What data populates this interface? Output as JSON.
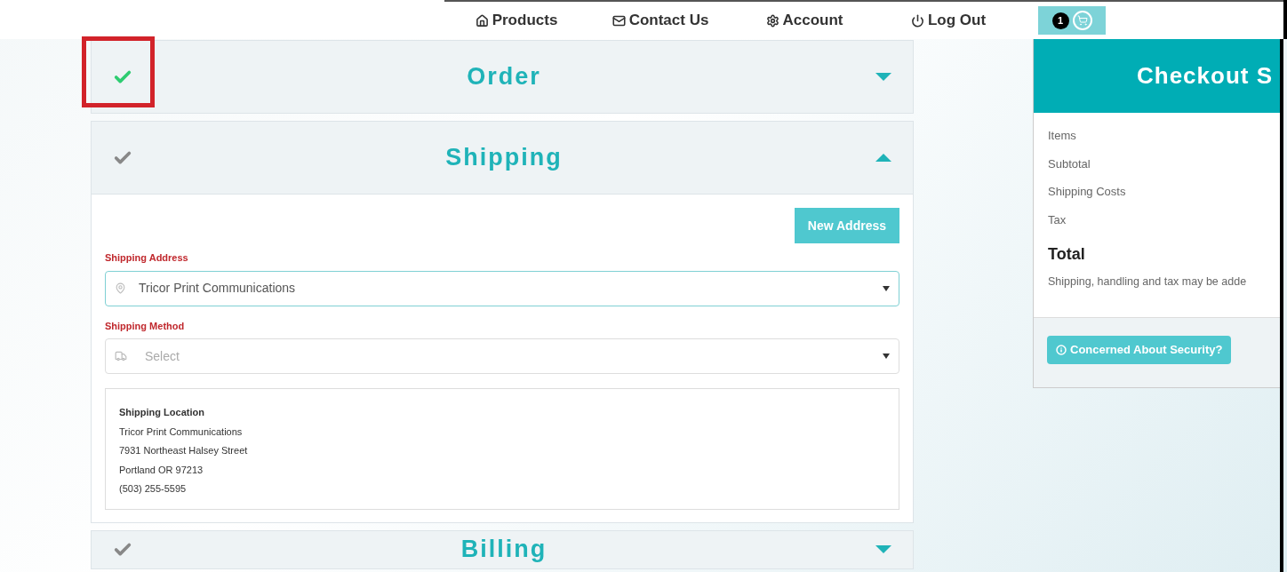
{
  "nav": {
    "items": [
      {
        "label": "Products"
      },
      {
        "label": "Contact Us"
      },
      {
        "label": "Account"
      },
      {
        "label": "Log Out"
      }
    ],
    "cart_count": "1"
  },
  "sections": [
    {
      "title": "Order",
      "completed": true,
      "expanded": false,
      "highlighted": true
    },
    {
      "title": "Shipping",
      "completed": false,
      "expanded": true,
      "highlighted": false
    },
    {
      "title": "Billing",
      "completed": false,
      "expanded": false,
      "highlighted": false
    }
  ],
  "shipping": {
    "new_address_button": "New Address",
    "address_label": "Shipping Address",
    "address_value": "Tricor Print Communications",
    "method_label": "Shipping Method",
    "method_placeholder": "Select",
    "location": {
      "title": "Shipping Location",
      "lines": [
        "Tricor Print Communications",
        "7931 Northeast Halsey Street",
        "Portland OR 97213",
        "(503) 255-5595"
      ]
    }
  },
  "summary": {
    "title": "Checkout S",
    "rows": [
      "Items",
      "Subtotal",
      "Shipping Costs",
      "Tax"
    ],
    "total_label": "Total",
    "note": "Shipping, handling and tax may be adde",
    "security_button": "Concerned About Security?"
  }
}
